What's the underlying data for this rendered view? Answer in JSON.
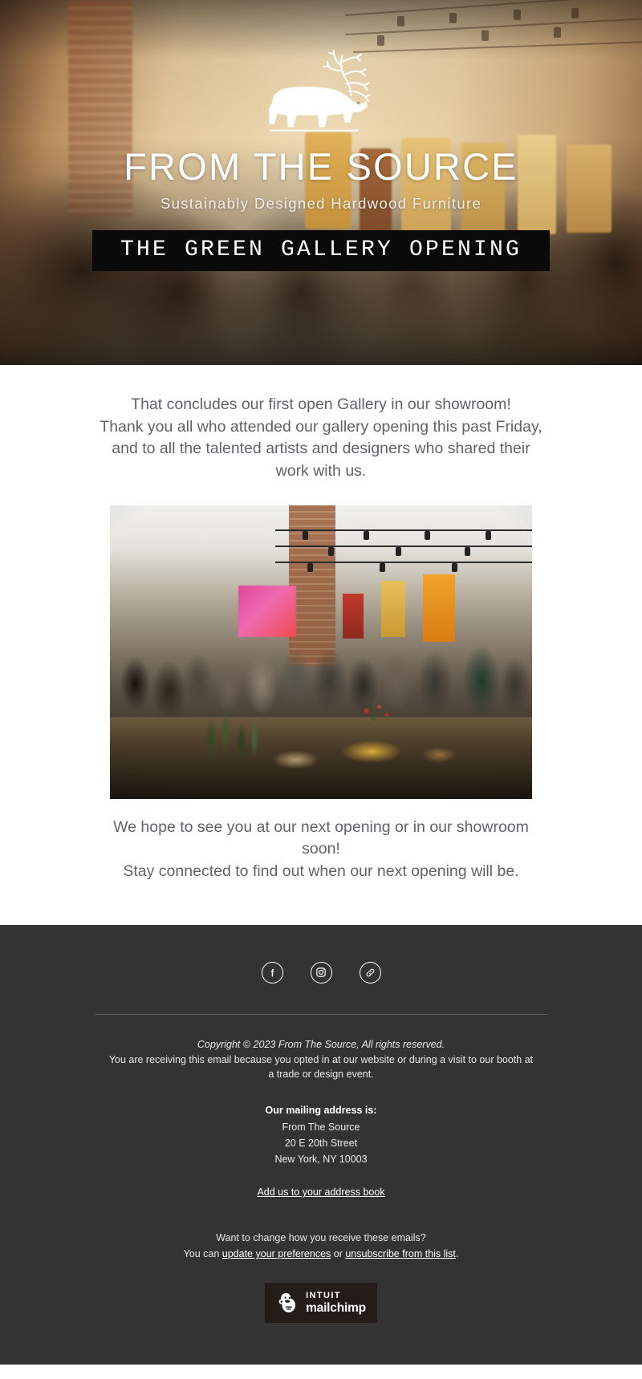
{
  "hero": {
    "logo_icon": "rhino-antler-logo-icon",
    "brand_title": "FROM THE SOURCE",
    "tagline": "Sustainably Designed Hardwood Furniture",
    "headline": "THE GREEN GALLERY OPENING",
    "headline_bar_color": "#0a0a0a"
  },
  "body": {
    "intro_lines": [
      "That concludes our first open Gallery in our showroom!",
      "Thank you all who attended our gallery opening this past Friday,",
      "and to all the talented artists and designers who shared their",
      "work with us."
    ],
    "photo_alt": "gallery-opening-crowd-photo",
    "outro_lines": [
      "We hope to see you at our next opening or in our showroom",
      "soon!",
      "Stay connected to find out when our next opening will be."
    ],
    "text_color": "#5f6467"
  },
  "footer": {
    "background": "#333333",
    "social": [
      {
        "name": "facebook",
        "icon": "facebook-icon"
      },
      {
        "name": "instagram",
        "icon": "instagram-icon"
      },
      {
        "name": "website",
        "icon": "link-icon"
      }
    ],
    "copyright": "Copyright © 2023 From The Source, All rights reserved.",
    "optin_notice": "You are receiving this email because you opted in at our website or during a visit to our booth at a trade or design event.",
    "address": {
      "title": "Our mailing address is:",
      "line1": "From The Source",
      "line2": "20 E 20th Street",
      "line3": "New York, NY 10003"
    },
    "address_book_link": "Add us to your address book",
    "prefs_question": "Want to change how you receive these emails?",
    "prefs_prefix": "You can ",
    "prefs_update_link": "update your preferences",
    "prefs_middle": " or ",
    "prefs_unsubscribe_link": "unsubscribe from this list",
    "prefs_suffix": ".",
    "mailchimp": {
      "icon": "mailchimp-freddie-icon",
      "line1": "INTUIT",
      "line2": "mailchimp",
      "background": "#241c18"
    }
  }
}
